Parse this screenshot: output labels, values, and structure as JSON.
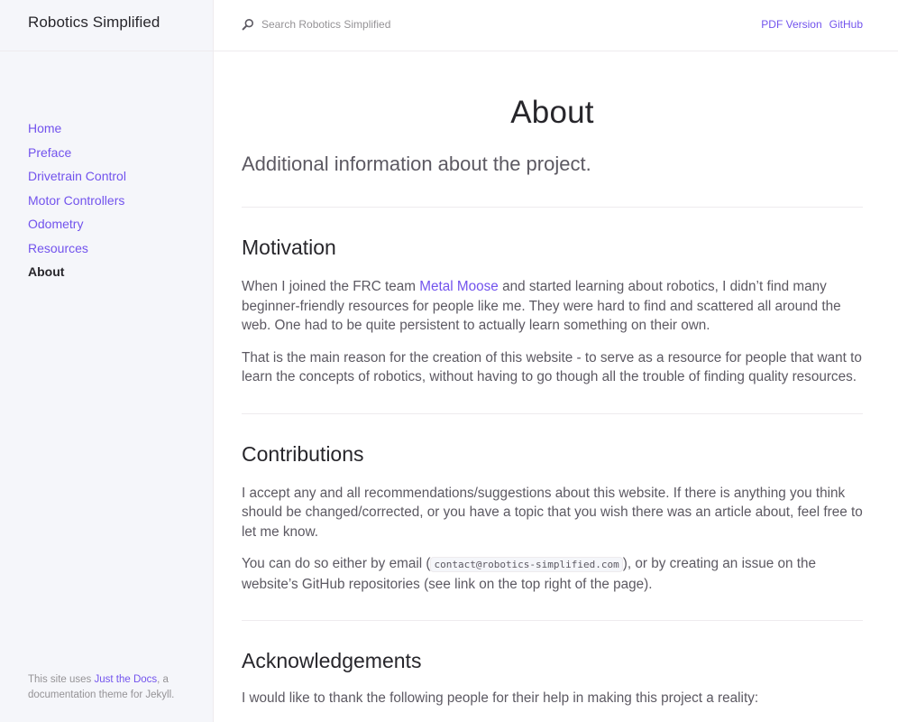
{
  "site": {
    "title": "Robotics Simplified"
  },
  "nav": {
    "items": [
      {
        "label": "Home"
      },
      {
        "label": "Preface"
      },
      {
        "label": "Drivetrain Control"
      },
      {
        "label": "Motor Controllers"
      },
      {
        "label": "Odometry"
      },
      {
        "label": "Resources"
      },
      {
        "label": "About"
      }
    ]
  },
  "footer": {
    "prefix": "This site uses ",
    "link": "Just the Docs",
    "suffix": ", a documentation theme for Jekyll."
  },
  "search": {
    "placeholder": "Search Robotics Simplified"
  },
  "aux_nav": {
    "pdf": "PDF Version",
    "github": "GitHub"
  },
  "page": {
    "title": "About",
    "lead": "Additional information about the project.",
    "motivation": {
      "heading": "Motivation",
      "p1_before": "When I joined the FRC team ",
      "p1_link": "Metal Moose",
      "p1_after": " and started learning about robotics, I didn’t find many beginner-friendly resources for people like me. They were hard to find and scattered all around the web. One had to be quite persistent to actually learn something on their own.",
      "p2": "That is the main reason for the creation of this website - to serve as a resource for people that want to learn the concepts of robotics, without having to go though all the trouble of finding quality resources."
    },
    "contributions": {
      "heading": "Contributions",
      "p1": "I accept any and all recommendations/suggestions about this website. If there is anything you think should be changed/corrected, or you have a topic that you wish there was an article about, feel free to let me know.",
      "p2_before": "You can do so either by email (",
      "p2_code": "contact@robotics-simplified.com",
      "p2_after": "), or by creating an issue on the website’s GitHub repositories (see link on the top right of the page)."
    },
    "acknowledgements": {
      "heading": "Acknowledgements",
      "p1": "I would like to thank the following people for their help in making this project a reality:"
    }
  },
  "colors": {
    "accent": "#7253ed",
    "heading": "#27262b",
    "body_text": "#5c5962",
    "sidebar_bg": "#f5f6fa",
    "border": "#eeebee"
  }
}
